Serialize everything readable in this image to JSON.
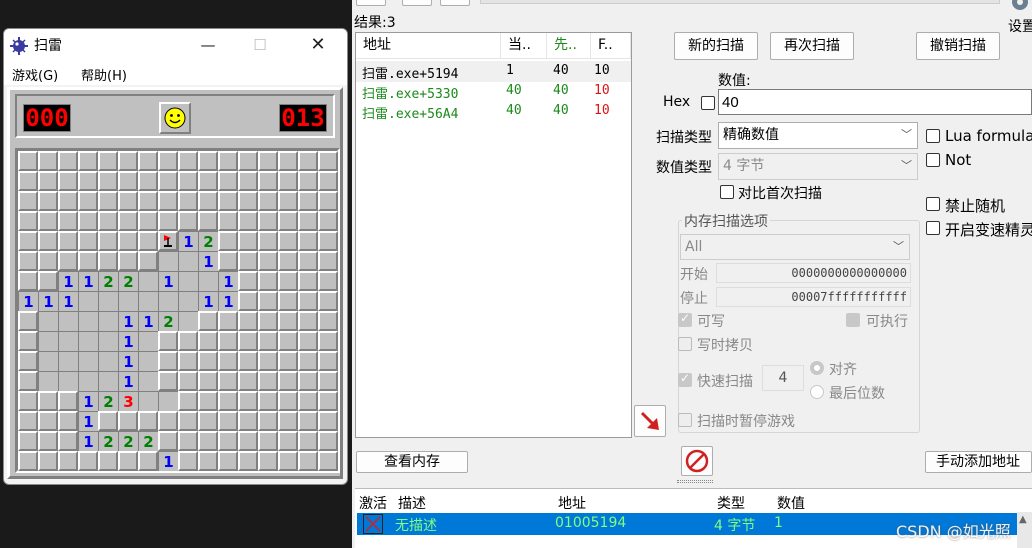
{
  "minesweeper": {
    "title": "扫雷",
    "menu": [
      "游戏(G)",
      "帮助(H)"
    ],
    "mines_counter": "000",
    "timer": "013",
    "window_controls": {
      "minimize": "—",
      "maximize": "☐",
      "close": "✕"
    },
    "board": [
      "################",
      "################",
      "################",
      "################",
      "#######F12######",
      "#######..1######",
      "##1122.1..1#####",
      "111......11#####",
      "#....112.#######",
      "#....1.#########",
      "#....1.#########",
      "#....1.#########",
      "###123..########",
      "###1############",
      "###1222#########",
      "#######1########"
    ]
  },
  "cheat_engine": {
    "result_count": "结果:3",
    "settings_label": "设置",
    "result_columns": [
      "地址",
      "当..",
      "先..",
      "F.."
    ],
    "results": [
      {
        "address": "扫雷.exe+5194",
        "current": "1",
        "previous": "40",
        "first": "10",
        "color": "#000000"
      },
      {
        "address": "扫雷.exe+5330",
        "current": "40",
        "previous": "40",
        "first": "10",
        "color": "#1a8a1a"
      },
      {
        "address": "扫雷.exe+56A4",
        "current": "40",
        "previous": "40",
        "first": "10",
        "color": "#1a8a1a"
      }
    ],
    "buttons": {
      "new_scan": "新的扫描",
      "next_scan": "再次扫描",
      "undo_scan": "撤销扫描",
      "memory_view": "查看内存",
      "add_address": "手动添加地址"
    },
    "value_label": "数值:",
    "hex_label": "Hex",
    "value": "40",
    "scan_type_label": "扫描类型",
    "scan_type": "精确数值",
    "value_type_label": "数值类型",
    "value_type": "4 字节",
    "compare_first_label": "对比首次扫描",
    "lua_formula_label": "Lua formula",
    "not_label": "Not",
    "disable_random_label": "禁止随机",
    "speedhack_label": "开启变速精灵",
    "memory_options_label": "内存扫描选项",
    "region": "All",
    "start_label": "开始",
    "start_value": "0000000000000000",
    "stop_label": "停止",
    "stop_value": "00007fffffffffff",
    "writable_label": "可写",
    "executable_label": "可执行",
    "copy_on_write_label": "写时拷贝",
    "fast_scan_label": "快速扫描",
    "fast_scan_value": "4",
    "align_label": "对齐",
    "last_digits_label": "最后位数",
    "pause_game_label": "扫描时暂停游戏",
    "address_list_columns": [
      "激活",
      "描述",
      "地址",
      "类型",
      "数值"
    ],
    "address_list": [
      {
        "description": "无描述",
        "address": "01005194",
        "type": "4 字节",
        "value": "1"
      }
    ]
  },
  "watermark": "CSDN @如光照",
  "colors": {
    "accent": "#0078d7",
    "lcd": "#ff0000",
    "green_row": "#1a8a1a",
    "red_value": "#e01010"
  }
}
